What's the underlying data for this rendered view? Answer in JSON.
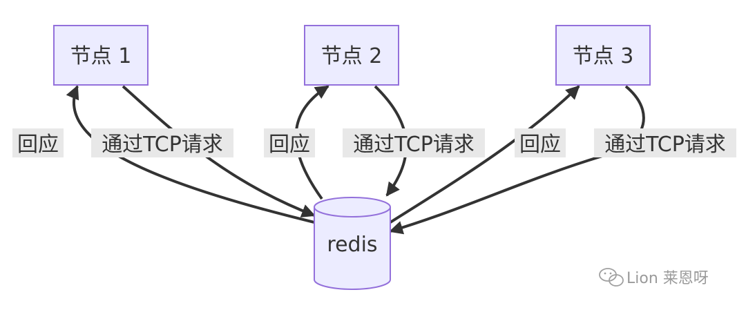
{
  "nodes": {
    "node1": "节点 1",
    "node2": "节点 2",
    "node3": "节点 3",
    "redis": "redis"
  },
  "edges": {
    "node1": {
      "request": "通过TCP请求",
      "reply": "回应"
    },
    "node2": {
      "request": "通过TCP请求",
      "reply": "回应"
    },
    "node3": {
      "request": "通过TCP请求",
      "reply": "回应"
    }
  },
  "watermark": {
    "text": "Lion 莱恩呀",
    "icon": "wechat-icon"
  },
  "colors": {
    "node_fill": "#ECECFF",
    "node_stroke": "#9370DB",
    "edge": "#333333",
    "label_bg": "#E8E8E8"
  }
}
